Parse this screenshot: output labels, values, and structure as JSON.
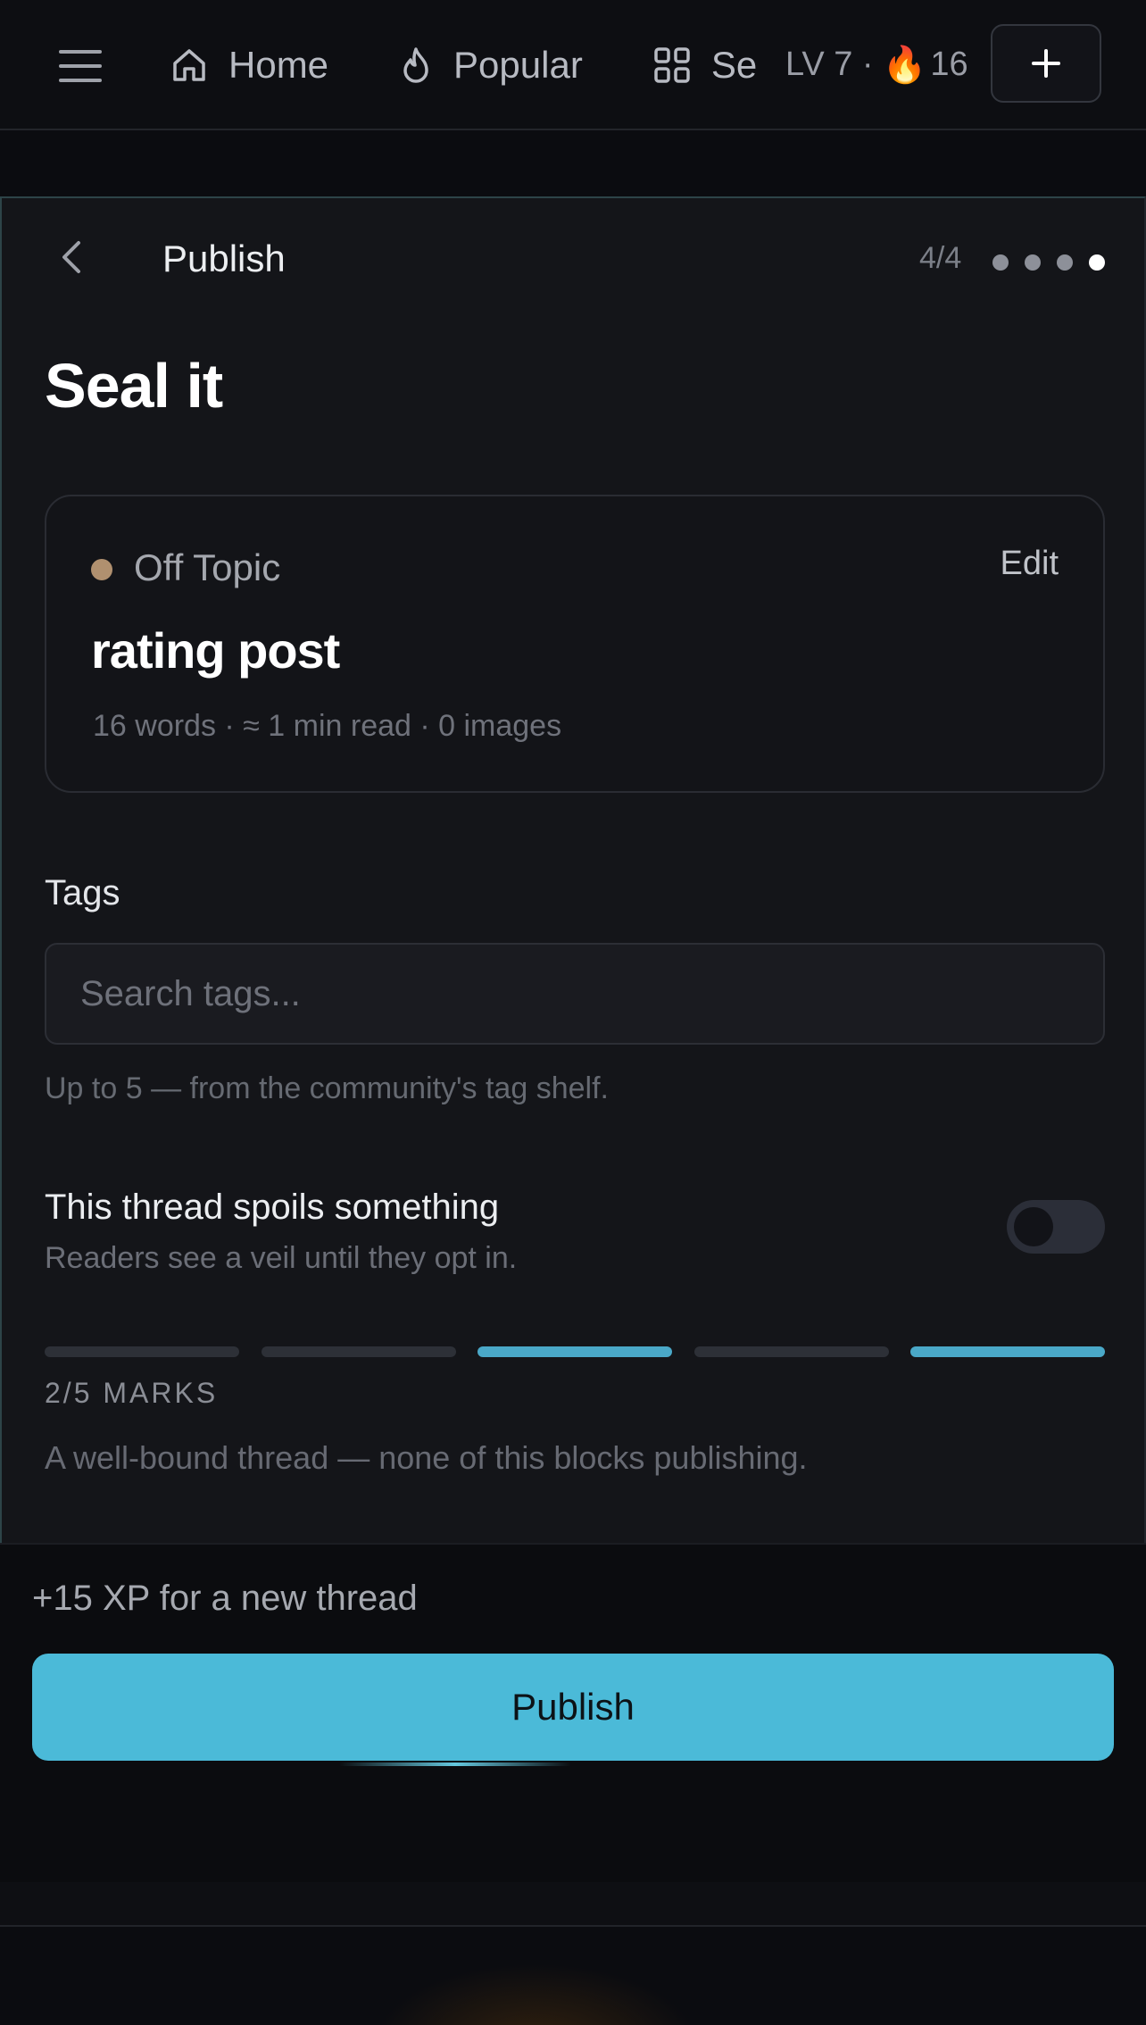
{
  "nav": {
    "items": [
      {
        "label": "Home",
        "icon": "home-icon"
      },
      {
        "label": "Popular",
        "icon": "flame-outline-icon"
      },
      {
        "label": "Se",
        "icon": "grid-icon"
      }
    ],
    "level_prefix": "LV 7 ·",
    "streak_emoji": "🔥",
    "streak_count": "16",
    "add_icon": "plus-icon"
  },
  "panel": {
    "title": "Publish",
    "step": "4/4",
    "step_total": 4,
    "step_current": 4,
    "heading": "Seal it"
  },
  "summary": {
    "category": "Off Topic",
    "category_color": "#b0906f",
    "edit_label": "Edit",
    "post_title": "rating post",
    "stats": "16 words · ≈ 1 min read · 0 images"
  },
  "tags": {
    "label": "Tags",
    "placeholder": "Search tags...",
    "value": "",
    "hint": "Up to 5 — from the community's tag shelf."
  },
  "spoiler": {
    "label": "This thread spoils something",
    "sub": "Readers see a veil until they opt in.",
    "enabled": false
  },
  "marks": {
    "segments": [
      false,
      false,
      true,
      false,
      true
    ],
    "label": "2/5 MARKS",
    "note": "A well-bound thread — none of this blocks publishing.",
    "accent": "#4aa8c8"
  },
  "footer": {
    "xp_note": "+15 XP for a new thread",
    "publish_label": "Publish",
    "accent": "#4bbad8"
  }
}
